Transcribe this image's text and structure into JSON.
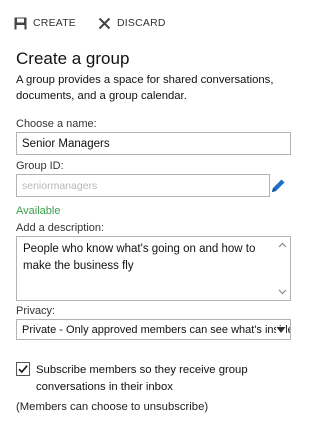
{
  "toolbar": {
    "create_label": "CREATE",
    "discard_label": "DISCARD",
    "create_icon": "save-icon",
    "discard_icon": "close-icon"
  },
  "page": {
    "title": "Create a group",
    "description": "A group provides a space for shared conversations, documents, and a group calendar."
  },
  "name": {
    "label": "Choose a name:",
    "value": "Senior Managers"
  },
  "group_id": {
    "label": "Group ID:",
    "placeholder": "seniormanagers",
    "status": "Available",
    "edit_icon": "pencil-icon"
  },
  "description": {
    "label": "Add a description:",
    "value": "People who know what's going on and how to make the business fly"
  },
  "privacy": {
    "label": "Privacy:",
    "selected": "Private - Only approved members can see what's inside"
  },
  "subscribe": {
    "checked": true,
    "label": "Subscribe members so they receive group conversations in their inbox",
    "note": "(Members can choose to unsubscribe)"
  },
  "colors": {
    "available": "#3aa04a",
    "accent": "#1e6fc2",
    "border": "#b3b3b3"
  }
}
